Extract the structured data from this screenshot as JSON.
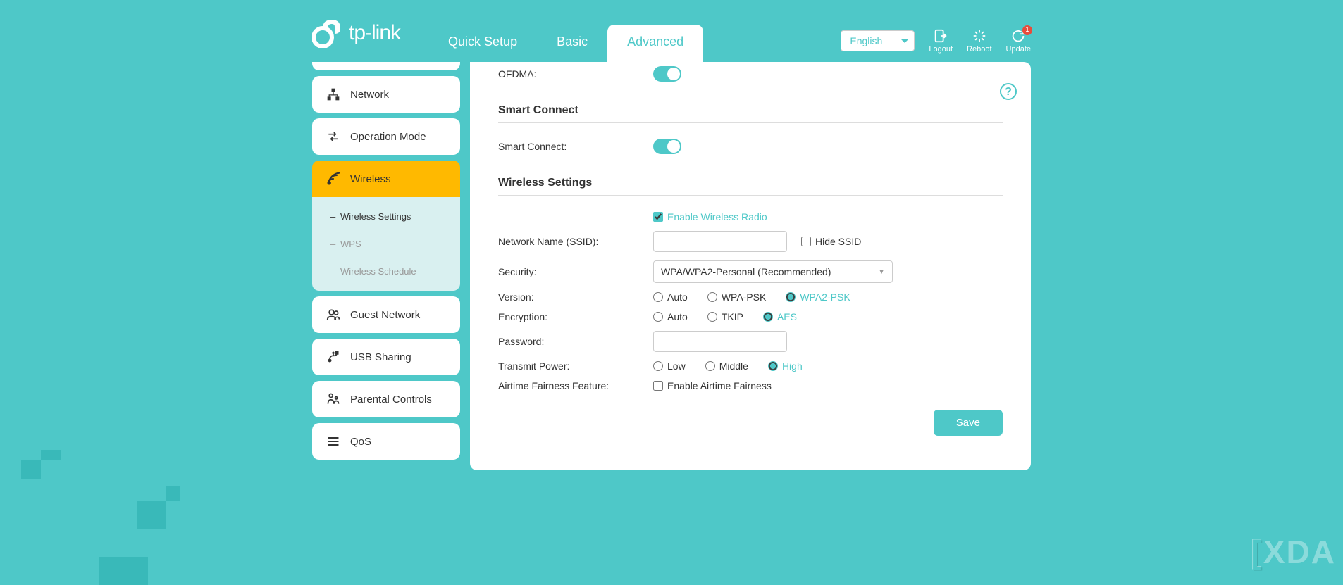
{
  "brand": "tp-link",
  "header": {
    "tabs": [
      "Quick Setup",
      "Basic",
      "Advanced"
    ],
    "active_tab": "Advanced",
    "language": "English",
    "actions": {
      "logout": "Logout",
      "reboot": "Reboot",
      "update": "Update",
      "update_badge": "1"
    }
  },
  "sidebar": {
    "items": [
      {
        "label": "Network"
      },
      {
        "label": "Operation Mode"
      },
      {
        "label": "Wireless",
        "active": true
      },
      {
        "label": "Guest Network"
      },
      {
        "label": "USB Sharing"
      },
      {
        "label": "Parental Controls"
      },
      {
        "label": "QoS"
      }
    ],
    "wireless_sub": [
      {
        "label": "Wireless Settings",
        "active": true
      },
      {
        "label": "WPS"
      },
      {
        "label": "Wireless Schedule"
      }
    ]
  },
  "content": {
    "ofdma_label": "OFDMA:",
    "smart_connect_title": "Smart Connect",
    "smart_connect_label": "Smart Connect:",
    "wireless_settings_title": "Wireless Settings",
    "enable_radio": "Enable Wireless Radio",
    "ssid_label": "Network Name (SSID):",
    "ssid_value": "",
    "hide_ssid": "Hide SSID",
    "security_label": "Security:",
    "security_value": "WPA/WPA2-Personal (Recommended)",
    "version_label": "Version:",
    "version_options": [
      "Auto",
      "WPA-PSK",
      "WPA2-PSK"
    ],
    "version_selected": "WPA2-PSK",
    "encryption_label": "Encryption:",
    "encryption_options": [
      "Auto",
      "TKIP",
      "AES"
    ],
    "encryption_selected": "AES",
    "password_label": "Password:",
    "password_value": "",
    "transmit_label": "Transmit Power:",
    "transmit_options": [
      "Low",
      "Middle",
      "High"
    ],
    "transmit_selected": "High",
    "airtime_label": "Airtime Fairness Feature:",
    "airtime_checkbox": "Enable Airtime Fairness",
    "save": "Save"
  },
  "watermark": "XDA"
}
